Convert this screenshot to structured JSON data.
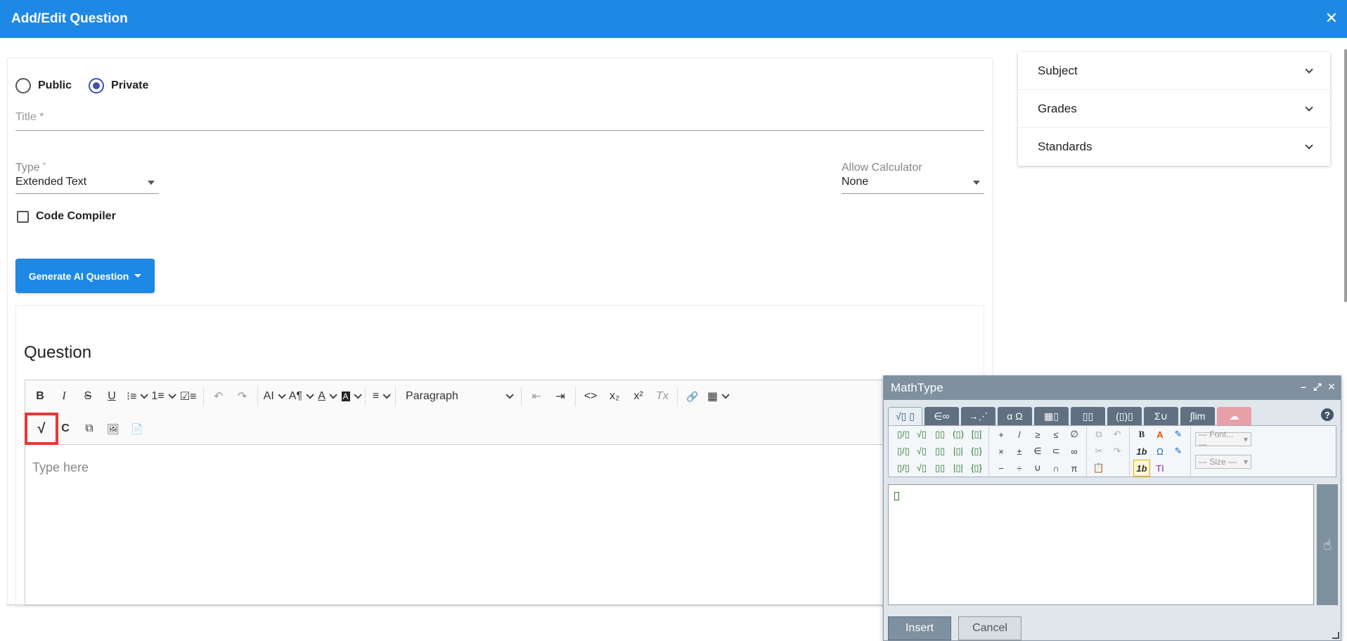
{
  "header": {
    "title": "Add/Edit Question",
    "close_icon": "✕"
  },
  "visibility": {
    "public_label": "Public",
    "private_label": "Private",
    "selected": "Private"
  },
  "form": {
    "title_placeholder": "Title *",
    "type_label": "Type",
    "type_required_mark": "*",
    "type_value": "Extended Text",
    "calculator_label": "Allow Calculator",
    "calculator_value": "None",
    "code_compiler_label": "Code Compiler"
  },
  "ai_button": {
    "label": "Generate AI Question"
  },
  "question": {
    "title": "Question",
    "placeholder": "Type here",
    "paragraph_value": "Paragraph"
  },
  "toolbar_icons": {
    "bold": "B",
    "italic": "I",
    "strike": "S",
    "underline": "U",
    "bullet": "⁝≡",
    "numbered": "1≡",
    "todo": "☑≡",
    "undo": "↶",
    "redo": "↷",
    "font_size": "AI",
    "font_family": "A¶",
    "font_color": "A",
    "bg_color": "A",
    "align": "≡",
    "outdent": "⇤",
    "indent": "⇥",
    "code": "<>",
    "subscript": "x₂",
    "superscript": "x²",
    "clear_format": "Tx",
    "link": "🔗",
    "table": "▦",
    "math": "√",
    "chem": "C",
    "media": "⧉",
    "image": "🖼",
    "doc": "📄"
  },
  "sidebar": {
    "items": [
      {
        "label": "Subject"
      },
      {
        "label": "Grades"
      },
      {
        "label": "Standards"
      }
    ]
  },
  "mathtype": {
    "title": "MathType",
    "win_minimize": "–",
    "win_maximize": "⤢",
    "win_close": "✕",
    "tabs": [
      "√▯ ▯",
      "∈∞",
      "→⋰",
      "α Ω",
      "▦▯",
      "▯▯",
      "(▯)▯",
      "Σ∪",
      "∫lim",
      "☁"
    ],
    "help": "?",
    "palette": {
      "g1": [
        "▯/▯",
        "▯/▯",
        "▯/▯"
      ],
      "g2": [
        "√▯",
        "√▯",
        "√▯"
      ],
      "g3": [
        "▯▯",
        "▯▯",
        "▯▯"
      ],
      "g4": [
        "(▯)",
        "|▯|",
        "|▯|"
      ],
      "g5": [
        "[▯]",
        "{▯}",
        "{▯}"
      ],
      "ops1": [
        "+",
        "×",
        "−"
      ],
      "ops2": [
        "/",
        "±",
        "÷"
      ],
      "ops3": [
        "≥",
        "∈",
        "∪"
      ],
      "ops4": [
        "≤",
        "⊂",
        "∩"
      ],
      "ops5": [
        "∅",
        "∞",
        "π"
      ],
      "ed1": [
        "⧉",
        "✂",
        "📋"
      ],
      "ed2": [
        "↶",
        "↷",
        ""
      ],
      "fmt1": [
        "B",
        "1b",
        "1b"
      ],
      "fmt2": [
        "A",
        "Ω",
        "TI"
      ],
      "fmt3": [
        "✎",
        "✎",
        ""
      ],
      "font_select": "— Font... —",
      "size_select": "— Size —"
    },
    "hand_icon": "☝",
    "insert_label": "Insert",
    "cancel_label": "Cancel"
  }
}
